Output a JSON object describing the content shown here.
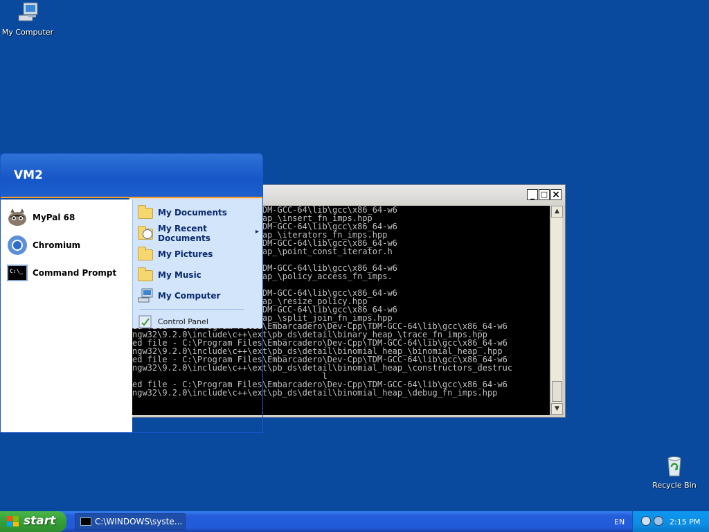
{
  "desktop": {
    "my_computer_label": "My Computer",
    "recycle_bin_label": "Recycle Bin",
    "background_color": "#0a4a9e"
  },
  "console": {
    "lines": [
      "iles\\Embarcadero\\Dev-Cpp\\TDM-GCC-64\\lib\\gcc\\x86_64-w6",
      "ext\\pb_ds\\detail\\binary_heap_\\insert_fn_imps.hpp",
      "iles\\Embarcadero\\Dev-Cpp\\TDM-GCC-64\\lib\\gcc\\x86_64-w6",
      "ext\\pb_ds\\detail\\binary_heap_\\iterators_fn_imps.hpp",
      "iles\\Embarcadero\\Dev-Cpp\\TDM-GCC-64\\lib\\gcc\\x86_64-w6",
      "ext\\pb_ds\\detail\\binary_heap_\\point_const_iterator.h",
      "",
      "iles\\Embarcadero\\Dev-Cpp\\TDM-GCC-64\\lib\\gcc\\x86_64-w6",
      "ext\\pb_ds\\detail\\binary_heap_\\policy_access_fn_imps.",
      "",
      "iles\\Embarcadero\\Dev-Cpp\\TDM-GCC-64\\lib\\gcc\\x86_64-w6",
      "ext\\pb_ds\\detail\\binary_heap_\\resize_policy.hpp",
      "iles\\Embarcadero\\Dev-Cpp\\TDM-GCC-64\\lib\\gcc\\x86_64-w6",
      "ext\\pb_ds\\detail\\binary_heap_\\split_join_fn_imps.hpp",
      "ed file - C:\\Program Files\\Embarcadero\\Dev-Cpp\\TDM-GCC-64\\lib\\gcc\\x86_64-w6",
      "ngw32\\9.2.0\\include\\c++\\ext\\pb_ds\\detail\\binary_heap_\\trace_fn_imps.hpp",
      "ed file - C:\\Program Files\\Embarcadero\\Dev-Cpp\\TDM-GCC-64\\lib\\gcc\\x86_64-w6",
      "ngw32\\9.2.0\\include\\c++\\ext\\pb_ds\\detail\\binomial_heap_\\binomial_heap_.hpp",
      "ed file - C:\\Program Files\\Embarcadero\\Dev-Cpp\\TDM-GCC-64\\lib\\gcc\\x86_64-w6",
      "ngw32\\9.2.0\\include\\c++\\ext\\pb_ds\\detail\\binomial_heap_\\constructors_destruc",
      "                                      l",
      "ed file - C:\\Program Files\\Embarcadero\\Dev-Cpp\\TDM-GCC-64\\lib\\gcc\\x86_64-w6",
      "ngw32\\9.2.0\\include\\c++\\ext\\pb_ds\\detail\\binomial_heap_\\debug_fn_imps.hpp"
    ],
    "minimize": "_",
    "maximize": "□",
    "close": "×"
  },
  "startmenu": {
    "user": "VM2",
    "left_items": [
      {
        "label": "MyPal 68",
        "icon": "mypal-icon"
      },
      {
        "label": "Chromium",
        "icon": "chromium-icon"
      },
      {
        "label": "Command Prompt",
        "icon": "cmd-icon"
      }
    ],
    "cmd_icon_text": "C:\\_",
    "right_items": [
      {
        "label": "My Documents"
      },
      {
        "label": "My Recent Documents",
        "arrow": "▸"
      },
      {
        "label": "My Pictures"
      },
      {
        "label": "My Music"
      },
      {
        "label": "My Computer"
      }
    ],
    "control_panel": "Control Panel"
  },
  "taskbar": {
    "start_label": "start",
    "task_label": "C:\\WINDOWS\\syste...",
    "lang": "EN",
    "time": "2:15 PM"
  }
}
